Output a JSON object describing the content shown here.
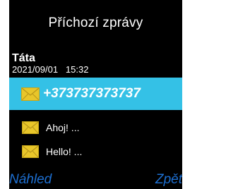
{
  "screen": {
    "title": "Příchozí zprávy"
  },
  "message": {
    "sender": "Táta",
    "date": "2021/09/01",
    "time": "15:32"
  },
  "list": {
    "selected": {
      "label": "+373737373737",
      "icon": "envelope-icon"
    },
    "items": [
      {
        "label": "Ahoj! ...",
        "icon": "envelope-icon"
      },
      {
        "label": "Hello! ...",
        "icon": "envelope-icon"
      }
    ]
  },
  "softkeys": {
    "left": "Náhled",
    "right": "Zpět"
  },
  "colors": {
    "background": "#000000",
    "highlight": "#34c1e6",
    "envelope": "#e8c62a",
    "softkey": "#1d6fd1"
  }
}
